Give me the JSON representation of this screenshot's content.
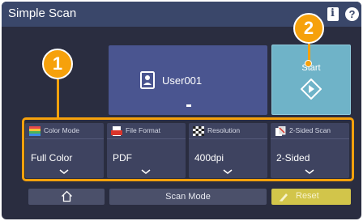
{
  "window": {
    "title": "Simple Scan",
    "info_icon": "info-icon",
    "help_icon": "help-icon",
    "help_glyph": "?"
  },
  "user_tile": {
    "icon": "user-document-icon",
    "label": "User001",
    "indicator": "-"
  },
  "start_button": {
    "label": "Start",
    "icon": "start-diamond-icon"
  },
  "settings": [
    {
      "title": "Color Mode",
      "value": "Full Color",
      "icon": "color-mode-icon"
    },
    {
      "title": "File Format",
      "value": "PDF",
      "icon": "file-format-icon"
    },
    {
      "title": "Resolution",
      "value": "400dpi",
      "icon": "resolution-icon"
    },
    {
      "title": "2-Sided Scan",
      "value": "2-Sided",
      "icon": "two-sided-scan-icon"
    }
  ],
  "bottom_bar": {
    "home_icon": "home-icon",
    "scan_mode_label": "Scan Mode",
    "reset_label": "Reset",
    "reset_icon": "eraser-icon"
  },
  "callouts": [
    "1",
    "2"
  ],
  "colors": {
    "accent_callout": "#f6a10c",
    "title_bar": "#3a476a",
    "user_tile": "#4a5590",
    "start_button": "#6fb3c8",
    "reset_button": "#d2c54a"
  }
}
